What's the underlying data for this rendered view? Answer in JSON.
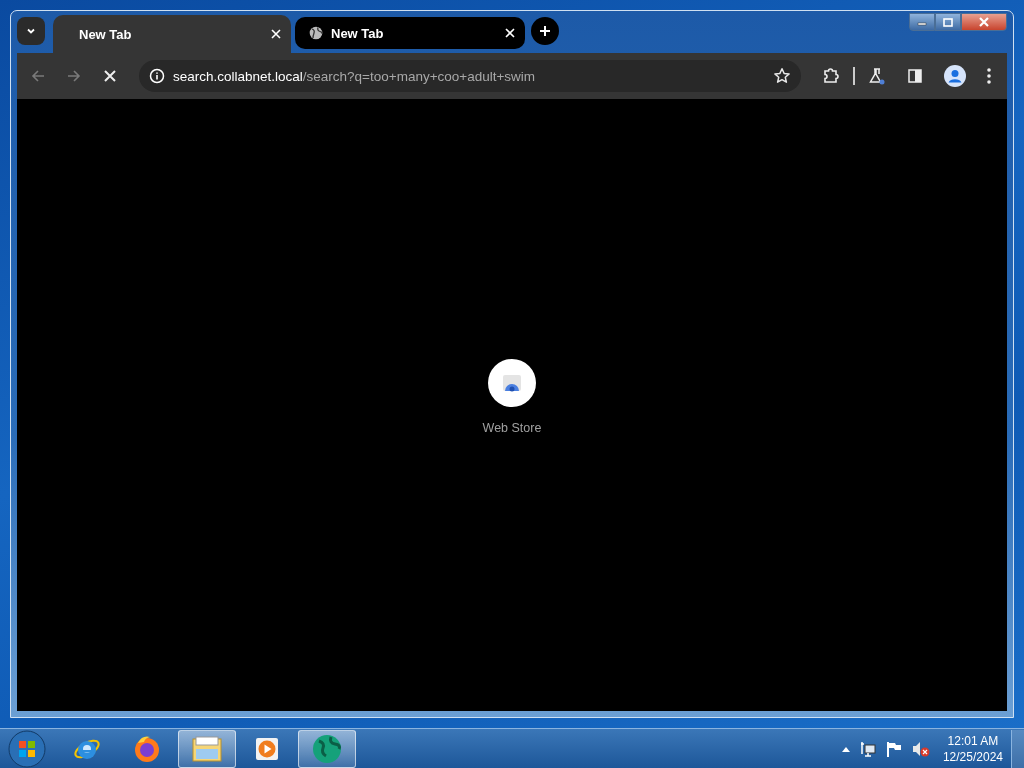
{
  "tabs": [
    {
      "title": "New Tab",
      "selected": true,
      "kind": "blank"
    },
    {
      "title": "New Tab",
      "selected": false,
      "kind": "globe"
    }
  ],
  "toolbar": {
    "back_disabled": true,
    "forward_disabled": true,
    "loading": true
  },
  "address": {
    "host": "search.collabnet.local",
    "path": "/search?q=too+many+coo+adult+swim"
  },
  "shortcut": {
    "label": "Web Store"
  },
  "taskbar": {
    "apps": [
      {
        "kind": "ie",
        "running": false
      },
      {
        "kind": "firefox",
        "running": false
      },
      {
        "kind": "explorer",
        "running": true
      },
      {
        "kind": "media",
        "running": false
      },
      {
        "kind": "globe",
        "running": true
      }
    ],
    "tray": {
      "volume_muted": true
    },
    "time": "12:01 AM",
    "date": "12/25/2024"
  }
}
